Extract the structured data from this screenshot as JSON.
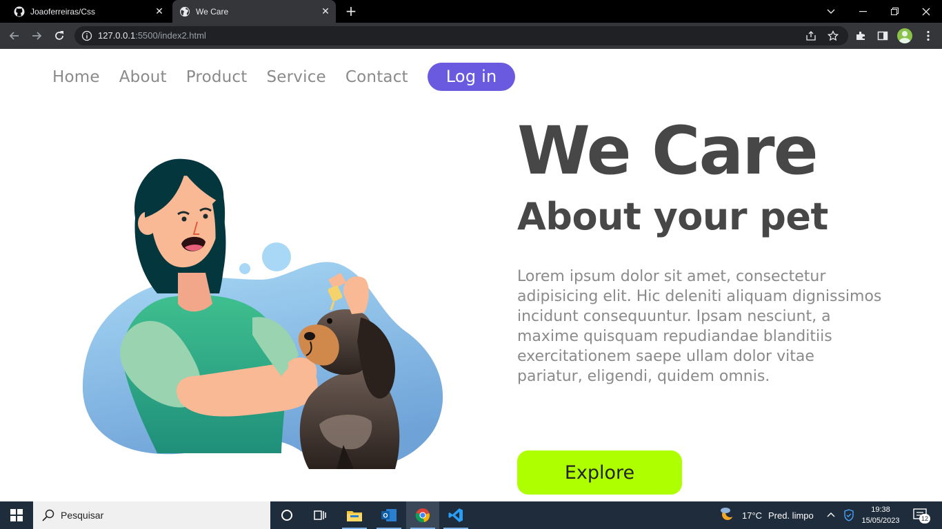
{
  "browser": {
    "tabs": [
      {
        "title": "Joaoferreiras/Css",
        "active": false,
        "favicon": "github-icon"
      },
      {
        "title": "We Care",
        "active": true,
        "favicon": "globe-icon"
      }
    ],
    "url_host": "127.0.0.1",
    "url_rest": ":5500/index2.html"
  },
  "nav": {
    "links": [
      "Home",
      "About",
      "Product",
      "Service",
      "Contact"
    ],
    "login": "Log in"
  },
  "hero": {
    "title": "We Care",
    "subtitle": "About your pet",
    "body": "Lorem ipsum dolor sit amet, consectetur adipisicing elit. Hic deleniti aliquam dignissimos incidunt consequuntur. Ipsam nesciunt, a maxime quisquam repudiandae blanditiis exercitationem saepe ullam dolor vitae pariatur, eligendi, quidem omnis.",
    "button": "Explore"
  },
  "taskbar": {
    "search_placeholder": "Pesquisar",
    "weather_temp": "17°C",
    "weather_desc": "Pred. limpo",
    "time": "19:38",
    "date": "15/05/2023",
    "notifications": "12"
  },
  "colors": {
    "login_bg": "#6a5ae0",
    "explore_bg": "#aeff00",
    "heading": "#474747",
    "text": "#8a8a8a"
  }
}
